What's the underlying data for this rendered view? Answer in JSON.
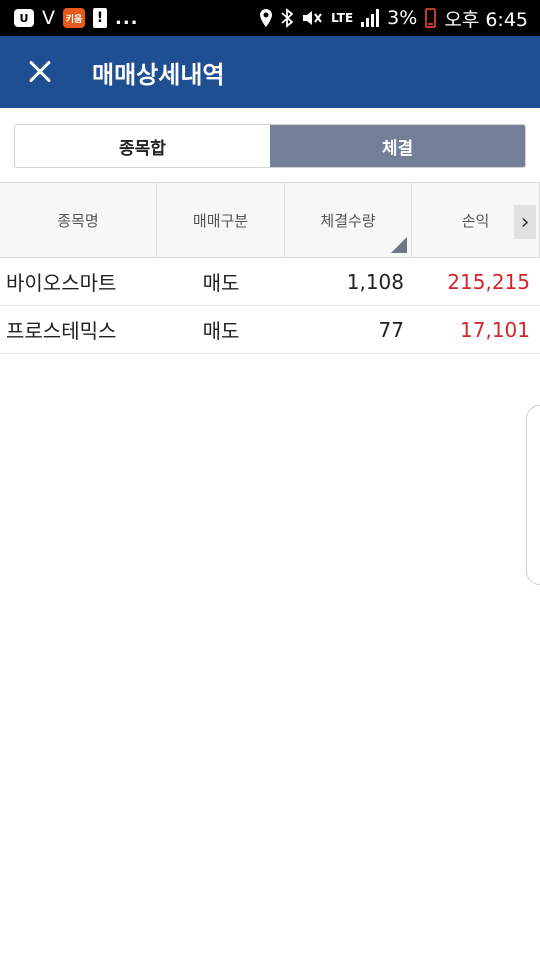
{
  "status_bar": {
    "icon_u": "U",
    "icon_v": "V",
    "icon_app": "키움",
    "icon_warn": "!",
    "more": "...",
    "lte": "LTE",
    "battery_pct": "3%",
    "time": "오후 6:45"
  },
  "header": {
    "title": "매매상세내역"
  },
  "tabs": [
    {
      "label": "종목합",
      "active": false
    },
    {
      "label": "체결",
      "active": true
    }
  ],
  "table": {
    "columns": [
      "종목명",
      "매매구분",
      "체결수량",
      "손익"
    ],
    "next_symbol": "›",
    "rows": [
      {
        "name": "바이오스마트",
        "type": "매도",
        "qty": "1,108",
        "pnl": "215,215"
      },
      {
        "name": "프로스테믹스",
        "type": "매도",
        "qty": "77",
        "pnl": "17,101"
      }
    ]
  },
  "colors": {
    "header_bg": "#1f4f93",
    "active_tab_bg": "#737f97",
    "profit_red": "#d0262c"
  }
}
